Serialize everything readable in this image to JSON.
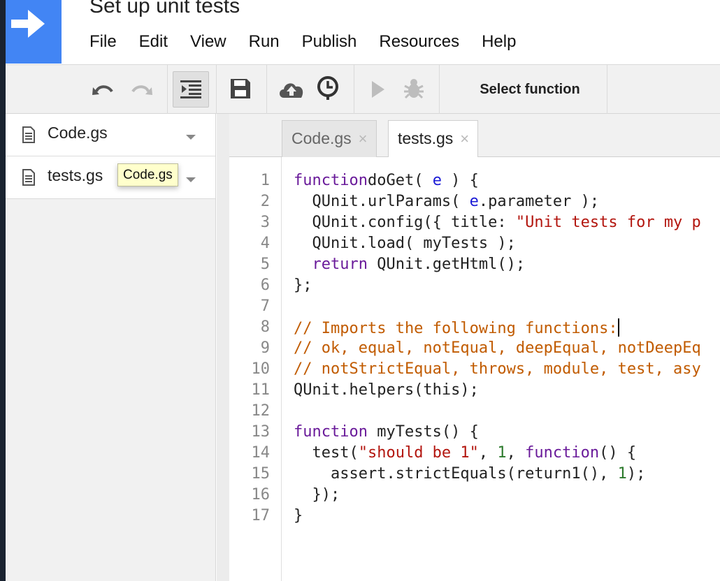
{
  "app": {
    "title": "Set up unit tests"
  },
  "menu": [
    "File",
    "Edit",
    "View",
    "Run",
    "Publish",
    "Resources",
    "Help"
  ],
  "toolbar": {
    "select_function_label": "Select function",
    "icons": [
      "undo-icon",
      "redo-icon",
      "indent-icon",
      "save-icon",
      "cloud-upload-icon",
      "clock-icon",
      "run-icon",
      "debug-icon"
    ]
  },
  "sidebar": {
    "files": [
      {
        "name": "Code.gs"
      },
      {
        "name": "tests.gs"
      }
    ],
    "tooltip": "Code.gs"
  },
  "tabs": [
    {
      "label": "Code.gs",
      "active": false,
      "close": "×"
    },
    {
      "label": "tests.gs",
      "active": true,
      "close": "×"
    }
  ],
  "editor": {
    "lines": [
      {
        "n": "1",
        "t": [
          [
            "kw",
            "function"
          ],
          [
            "",
            "doGet( "
          ],
          [
            "var",
            "e"
          ],
          [
            "",
            " ) {"
          ]
        ]
      },
      {
        "n": "2",
        "t": [
          [
            "",
            "  QUnit.urlParams( "
          ],
          [
            "var",
            "e"
          ],
          [
            "",
            ".parameter );"
          ]
        ]
      },
      {
        "n": "3",
        "t": [
          [
            "",
            "  QUnit.config({ title: "
          ],
          [
            "str",
            "\"Unit tests for my p"
          ]
        ]
      },
      {
        "n": "4",
        "t": [
          [
            "",
            "  QUnit.load( myTests );"
          ]
        ]
      },
      {
        "n": "5",
        "t": [
          [
            "",
            "  "
          ],
          [
            "kw",
            "return"
          ],
          [
            "",
            " QUnit.getHtml();"
          ]
        ]
      },
      {
        "n": "6",
        "t": [
          [
            "",
            "};"
          ]
        ]
      },
      {
        "n": "7",
        "t": []
      },
      {
        "n": "8",
        "t": [
          [
            "cmt",
            "// Imports the following functions:"
          ]
        ],
        "cursor": true
      },
      {
        "n": "9",
        "t": [
          [
            "cmt",
            "// ok, equal, notEqual, deepEqual, notDeepEq"
          ]
        ]
      },
      {
        "n": "10",
        "t": [
          [
            "cmt",
            "// notStrictEqual, throws, module, test, asy"
          ]
        ]
      },
      {
        "n": "11",
        "t": [
          [
            "",
            "QUnit.helpers(this);"
          ]
        ]
      },
      {
        "n": "12",
        "t": []
      },
      {
        "n": "13",
        "t": [
          [
            "kw",
            "function"
          ],
          [
            "",
            " myTests() {"
          ]
        ]
      },
      {
        "n": "14",
        "t": [
          [
            "",
            "  test("
          ],
          [
            "str",
            "\"should be 1\""
          ],
          [
            "",
            ", "
          ],
          [
            "num",
            "1"
          ],
          [
            "",
            ", "
          ],
          [
            "kw",
            "function"
          ],
          [
            "",
            "() {"
          ]
        ]
      },
      {
        "n": "15",
        "t": [
          [
            "",
            "    assert.strictEquals(return1(), "
          ],
          [
            "num",
            "1"
          ],
          [
            "",
            ");"
          ]
        ]
      },
      {
        "n": "16",
        "t": [
          [
            "",
            "  });"
          ]
        ]
      },
      {
        "n": "17",
        "t": [
          [
            "",
            "}"
          ]
        ]
      }
    ]
  },
  "colors": {
    "logo": "#4285f4",
    "keyword": "#6a1b9a",
    "variable": "#1a1ad6",
    "string": "#b3160f",
    "number": "#2c7a2c",
    "comment": "#c15b00"
  }
}
